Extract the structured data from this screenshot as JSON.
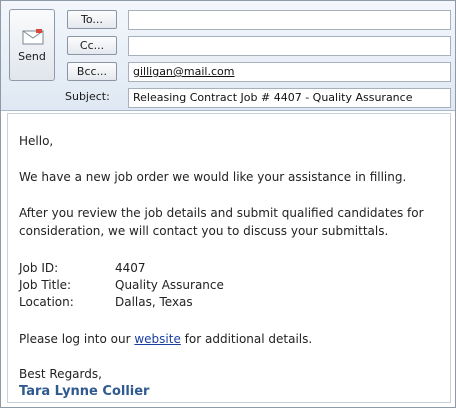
{
  "compose": {
    "send_label": "Send",
    "to_label": "To...",
    "cc_label": "Cc...",
    "bcc_label": "Bcc...",
    "to_value": "",
    "cc_value": "",
    "bcc_value": "gilligan@mail.com",
    "subject_label": "Subject:",
    "subject_value": "Releasing Contract Job # 4407 - Quality Assurance"
  },
  "message": {
    "greeting": "Hello,",
    "para1": "We have a new job order we would like your assistance in filling.",
    "para2_line1": "After you review the job details and submit qualified candidates for",
    "para2_line2": "consideration, we will contact you to discuss your submittals.",
    "details": [
      {
        "label": "Job ID:",
        "value": "4407"
      },
      {
        "label": "Job Title:",
        "value": "Quality Assurance"
      },
      {
        "label": "Location:",
        "value": "Dallas, Texas"
      }
    ],
    "cta_before": "Please log into our ",
    "cta_link": "website",
    "cta_after": " for additional details.",
    "closing": "Best Regards,",
    "signature": "Tara Lynne Collier"
  },
  "colors": {
    "link": "#1a3fa0",
    "signature": "#2f5a8f",
    "header_bg": "#dfe8f3"
  }
}
